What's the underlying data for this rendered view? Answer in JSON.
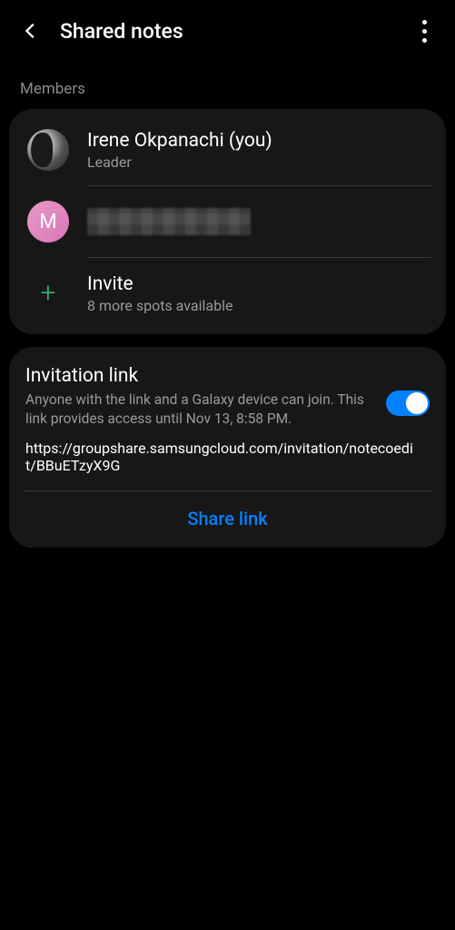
{
  "header": {
    "title": "Shared notes"
  },
  "members_label": "Members",
  "members": [
    {
      "name": "Irene Okpanachi (you)",
      "role": "Leader",
      "avatar_initial": ""
    },
    {
      "name": "",
      "role": "",
      "avatar_initial": "M"
    }
  ],
  "invite": {
    "label": "Invite",
    "subtext": "8 more spots available"
  },
  "invitation": {
    "title": "Invitation link",
    "description": "Anyone with the link and a Galaxy device can join. This link provides access until Nov 13, 8:58 PM.",
    "url": "https://groupshare.samsungcloud.com/invitation/notecoedit/BBuETzyX9G",
    "toggle_on": true,
    "share_label": "Share link"
  }
}
